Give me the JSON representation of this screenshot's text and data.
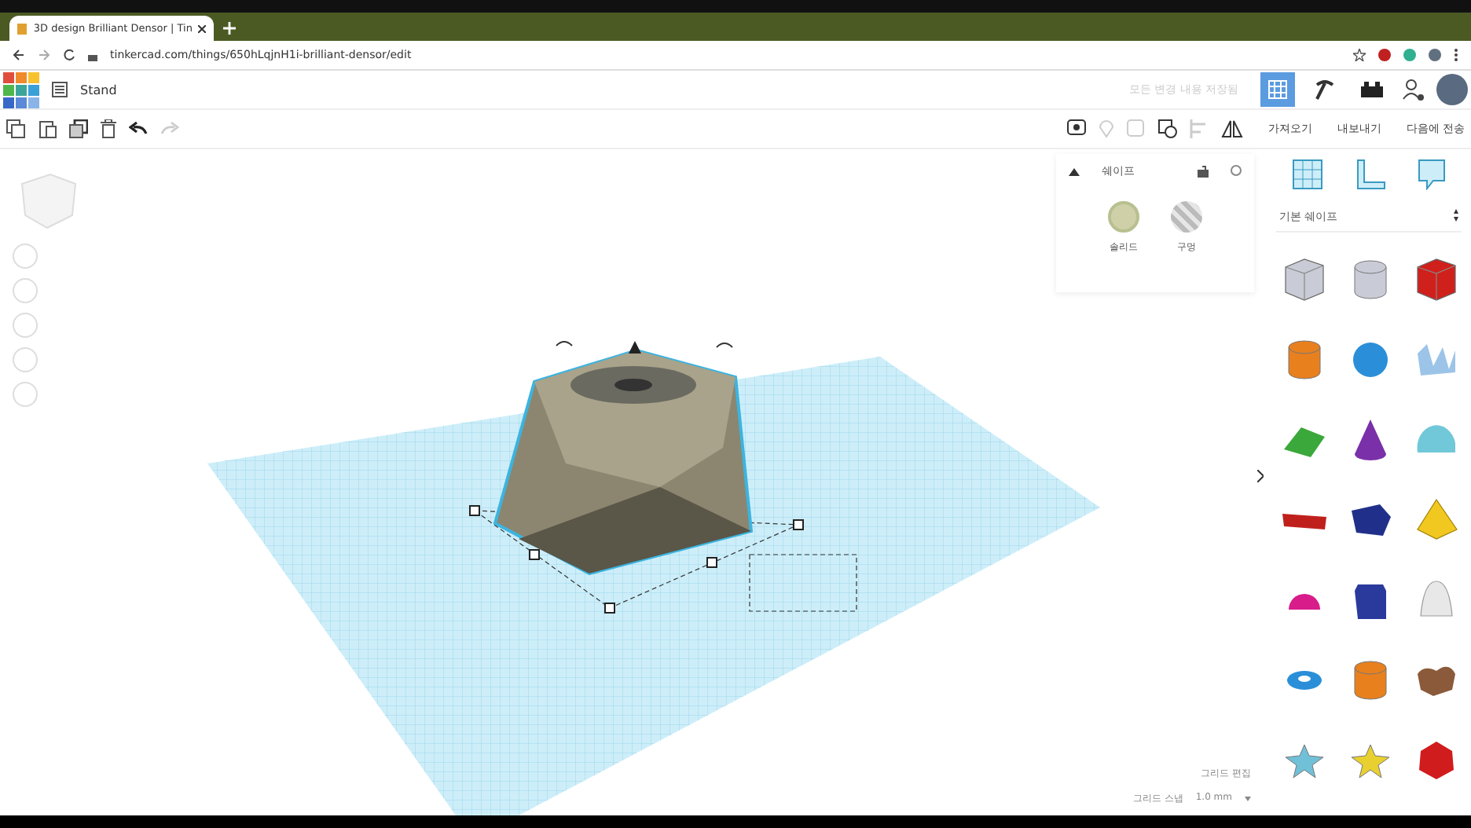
{
  "browser": {
    "tabs": [
      {
        "title": "3D design Brilliant Densor | Tin",
        "selected": true
      }
    ],
    "url": "tinkercad.com/things/650hLqjnH1i-brilliant-densor/edit"
  },
  "app": {
    "design_name": "Stand",
    "save_status": "모든 변경 내용 저장됨",
    "actions": [
      "가져오기",
      "내보내기",
      "다음에 전송"
    ]
  },
  "inspector": {
    "title": "쉐이프",
    "options": [
      {
        "label": "솔리드",
        "kind": "solid",
        "selected": true
      },
      {
        "label": "구멍",
        "kind": "hole",
        "selected": false
      }
    ]
  },
  "library": {
    "category": "기본 쉐이프",
    "shapes": [
      {
        "kind": "box",
        "color": "#c9ccd6"
      },
      {
        "kind": "cylinder",
        "color": "#c9ccd6"
      },
      {
        "kind": "box",
        "color": "#d0201c"
      },
      {
        "kind": "cylinder",
        "color": "#e8801e"
      },
      {
        "kind": "sphere",
        "color": "#2a8fd8"
      },
      {
        "kind": "wave",
        "color": "#9cc4e8"
      },
      {
        "kind": "roof",
        "color": "#3aa83a"
      },
      {
        "kind": "cone",
        "color": "#7a30a8"
      },
      {
        "kind": "halfcylinder",
        "color": "#70c8d8"
      },
      {
        "kind": "text",
        "color": "#c0201c"
      },
      {
        "kind": "polygon",
        "color": "#20308a"
      },
      {
        "kind": "pyramid",
        "color": "#f0c820"
      },
      {
        "kind": "hemisphere",
        "color": "#d81c8a"
      },
      {
        "kind": "prism",
        "color": "#2a3a9c"
      },
      {
        "kind": "paraboloid",
        "color": "#e8e8e8"
      },
      {
        "kind": "torus",
        "color": "#2a8fd8"
      },
      {
        "kind": "tube",
        "color": "#e8801e"
      },
      {
        "kind": "heart",
        "color": "#8a5a3a"
      },
      {
        "kind": "star",
        "color": "#70c0d8"
      },
      {
        "kind": "star",
        "color": "#e8d030"
      },
      {
        "kind": "polyhedron",
        "color": "#d01c1c"
      }
    ]
  },
  "grid": {
    "edit_label": "그리드 편집",
    "snap_label": "그리드 스냅",
    "snap_value": "1.0 mm"
  }
}
